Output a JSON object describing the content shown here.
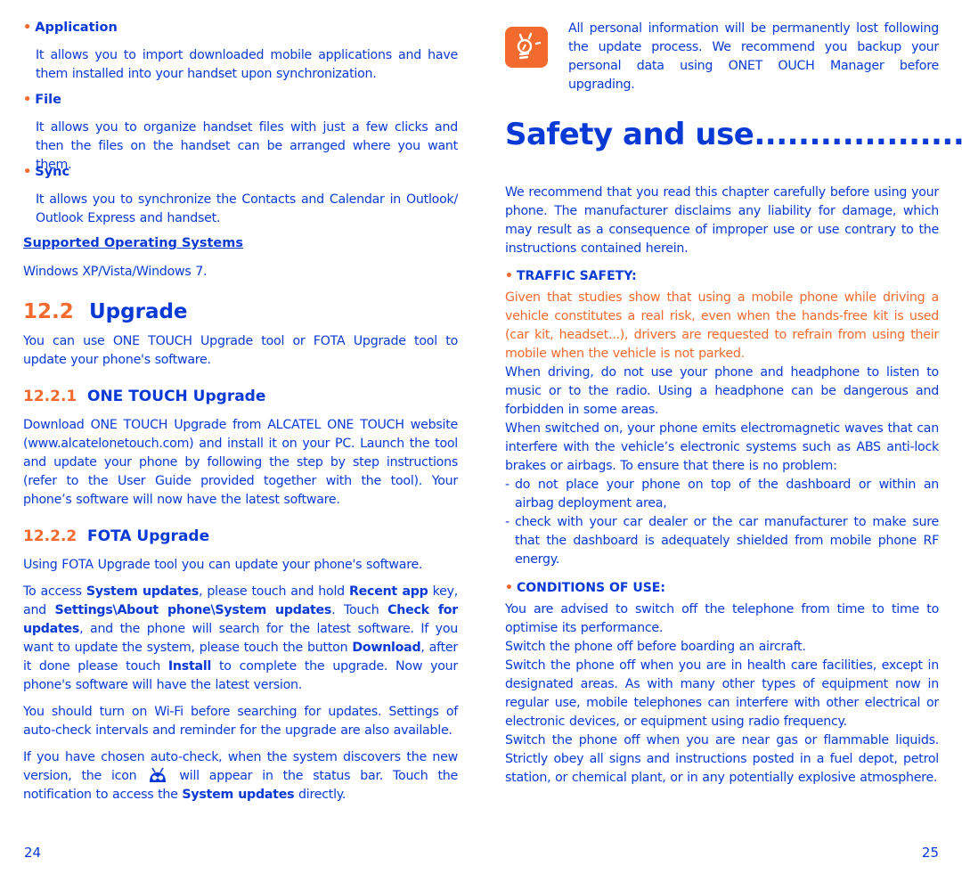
{
  "left_page": {
    "items": [
      {
        "title": "Application",
        "text": "It allows you to import downloaded mobile applications and have them installed into your handset upon synchronization."
      },
      {
        "title": "File",
        "text": "It allows you to organize handset files with just a few clicks and then the files on the handset can be arranged where you want them."
      },
      {
        "title": "Sync",
        "text": "It allows you to synchronize the Contacts and Calendar in Outlook/ Outlook Express and handset."
      }
    ],
    "supported_os_heading": "Supported Operating Systems",
    "supported_os_text": "Windows XP/Vista/Windows 7.",
    "section": {
      "number": "12.2",
      "title": "Upgrade",
      "intro": "You can use ONE TOUCH Upgrade tool or FOTA Upgrade tool to update your phone's software."
    },
    "sub1": {
      "number": "12.2.1",
      "title": "ONE TOUCH Upgrade",
      "text": "Download ONE TOUCH Upgrade from ALCATEL ONE TOUCH website (www.alcatelonetouch.com) and install it on your PC. Launch the tool and update your phone by following the step by step instructions (refer to the User Guide provided together with the tool). Your phone’s software will now have the latest software."
    },
    "sub2": {
      "number": "12.2.2",
      "title": "FOTA Upgrade",
      "intro": "Using FOTA Upgrade tool you can update your phone's software.",
      "access": {
        "p1": "To access ",
        "b1": "System updates",
        "p2": ", please touch and hold ",
        "b2": "Recent app",
        "p3": " key, and ",
        "b3": "Settings\\About phone\\System updates",
        "p4": ". Touch ",
        "b4": "Check for updates",
        "p5": ", and the phone will search for the latest software. If you want to update the system, please touch the button ",
        "b5": "Download",
        "p6": ", after it done please touch ",
        "b6": "Install",
        "p7": " to complete the upgrade. Now your phone's software will have the latest version."
      },
      "wifi_text": "You should turn on Wi-Fi before searching for updates. Settings of auto-check intervals and reminder for the upgrade are also available.",
      "autocheck": {
        "p1": "If you have chosen auto-check, when the system discovers the new version, the  icon",
        "icon": "system-update-android-icon",
        "p2": " will appear in the status bar. Touch the notification to access the ",
        "b1": "System updates",
        "p3": " directly."
      }
    },
    "page_number": "24"
  },
  "right_page": {
    "tip": {
      "icon": "lightbulb-tip-icon",
      "text": "All personal information will be permanently lost following the update process. We recommend you backup your personal data using ONET OUCH Manager before upgrading."
    },
    "chapter_title": "Safety and use......................",
    "intro": "We recommend that you read this chapter carefully before using your phone. The manufacturer disclaims any liability for damage, which may result as a consequence of improper use or use contrary to the instructions contained herein.",
    "traffic": {
      "heading": "TRAFFIC SAFETY:",
      "warning": "Given that studies show that using a mobile phone while driving a vehicle constitutes a real risk, even when the hands-free kit is used (car kit, headset...), drivers are requested to refrain from using their mobile when the vehicle is not parked.",
      "p1": "When driving, do not use your phone and headphone to listen to music or to the radio. Using a headphone can be dangerous and forbidden in some areas.",
      "p2": "When switched on, your phone emits electromagnetic waves that can interfere with the vehicle’s electronic systems such as ABS anti-lock brakes or airbags. To ensure that there is no problem:",
      "dash_items": [
        "do not place your phone on top of the dashboard or within an airbag deployment area,",
        "check with your car dealer or the car manufacturer to make sure that the dashboard is adequately shielded from mobile phone RF energy."
      ]
    },
    "conditions": {
      "heading": "CONDITIONS OF USE:",
      "paragraphs": [
        "You are advised to switch off the telephone from time to time to optimise its performance.",
        "Switch the phone off before boarding an aircraft.",
        "Switch the phone off when you are in health care facilities, except in designated areas. As with many other types of equipment now in regular use, mobile telephones can interfere with other electrical or electronic devices, or equipment using radio frequency.",
        "Switch the phone off when you are near gas or flammable liquids. Strictly obey all signs and instructions posted in a fuel depot, petrol station, or chemical plant, or in any potentially explosive atmosphere."
      ]
    },
    "page_number": "25"
  },
  "colors": {
    "text_blue": "#0a3ad6",
    "accent_orange": "#f26a2e"
  },
  "bullet_glyph": "•",
  "dash_glyph": "-"
}
